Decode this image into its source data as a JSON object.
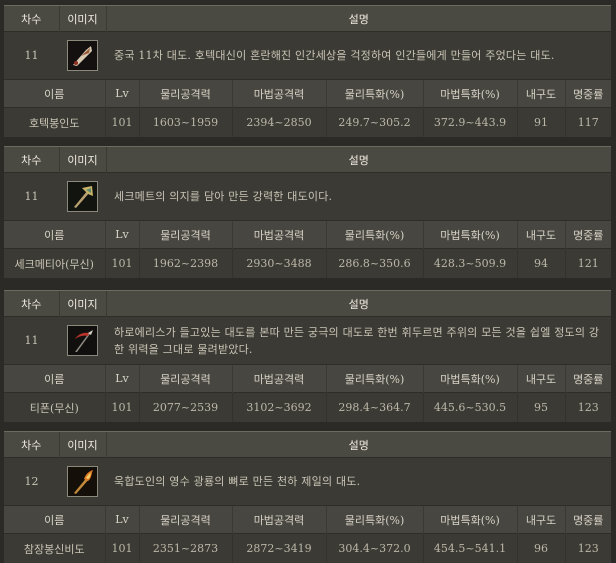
{
  "headers": {
    "tier": "차수",
    "image": "이미지",
    "description": "설명"
  },
  "stat_headers": [
    "이름",
    "Lv",
    "물리공격력",
    "마법공격력",
    "물리특화(%)",
    "마법특화(%)",
    "내구도",
    "명중률"
  ],
  "weapons": [
    {
      "tier": "11",
      "icon": "hawk-glaive-icon",
      "description": "중국 11차 대도. 호텍대신이 혼란해진 인간세상을 걱정하여 인간들에게 만들어 주었다는 대도.",
      "stats": [
        "호텍봉인도",
        "101",
        "1603~1959",
        "2394~2850",
        "249.7~305.2",
        "372.9~443.9",
        "91",
        "117"
      ]
    },
    {
      "tier": "11",
      "icon": "golden-axe-glaive-icon",
      "description": "세크메트의 의지를 담아 만든 강력한 대도이다.",
      "stats": [
        "세크메티아(무신)",
        "101",
        "1962~2398",
        "2930~3488",
        "286.8~350.6",
        "428.3~509.9",
        "94",
        "121"
      ]
    },
    {
      "tier": "11",
      "icon": "red-scythe-icon",
      "description": "하로에리스가 들고있는 대도를 본따 만든 궁극의 대도로 한번 휘두르면 주위의 모든 것을 쉽엘 정도의 강한 위력을 그대로 물려받았다.",
      "stats": [
        "티폰(무신)",
        "101",
        "2077~2539",
        "3102~3692",
        "298.4~364.7",
        "445.6~530.5",
        "95",
        "123"
      ]
    },
    {
      "tier": "12",
      "icon": "flame-glaive-icon",
      "description": "욱합도인의 영수 광룡의 뼈로 만든 천하 제일의 대도.",
      "stats": [
        "참장봉신비도",
        "101",
        "2351~2873",
        "2872~3419",
        "304.4~372.0",
        "454.5~541.1",
        "96",
        "123"
      ]
    }
  ]
}
